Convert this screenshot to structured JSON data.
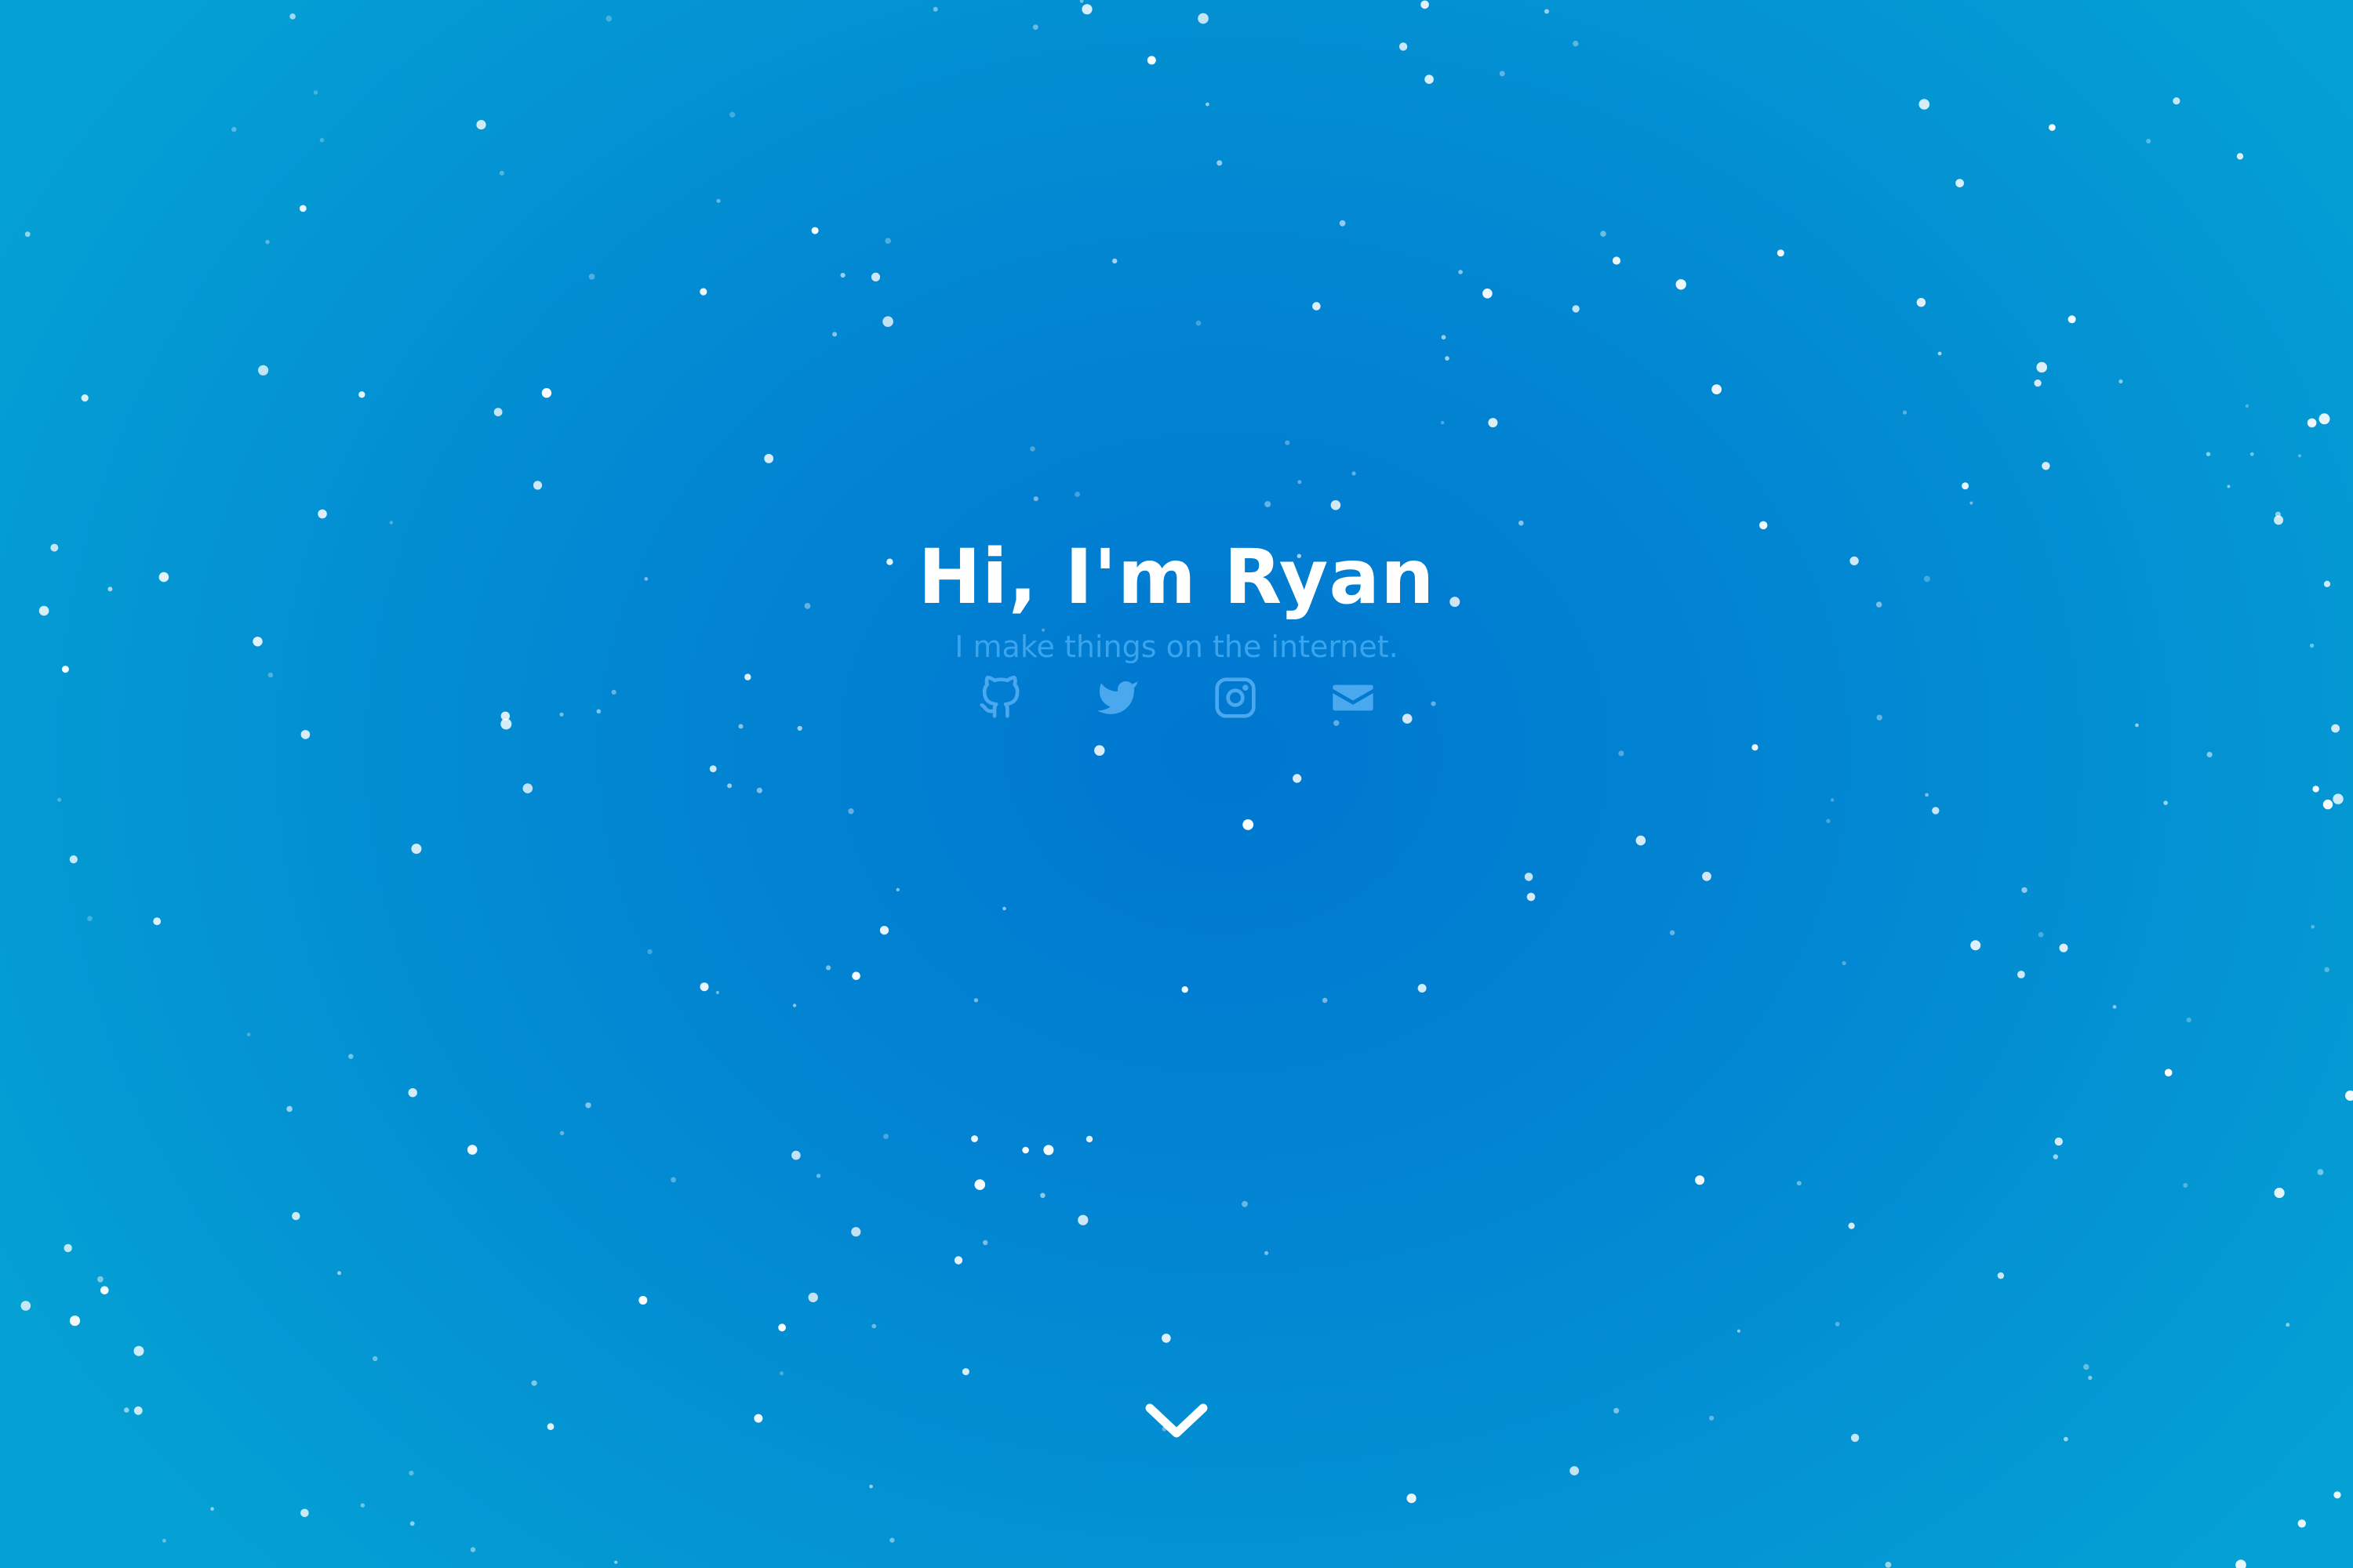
{
  "hero": {
    "title": "Hi, I'm Ryan",
    "tagline": "I make things on the internet."
  },
  "social": [
    {
      "name": "github-icon",
      "label": "GitHub"
    },
    {
      "name": "twitter-icon",
      "label": "Twitter"
    },
    {
      "name": "instagram-icon",
      "label": "Instagram"
    },
    {
      "name": "email-icon",
      "label": "Email"
    }
  ],
  "scroll": {
    "icon": "chevron-down-icon",
    "label": "Scroll down"
  },
  "colors": {
    "background_center": "#0077d0",
    "background_edge": "#05a1d4",
    "title": "#ffffff",
    "tagline": "#3aa4ec",
    "icons": "#4aa8ee",
    "stars": "#ffffff"
  }
}
